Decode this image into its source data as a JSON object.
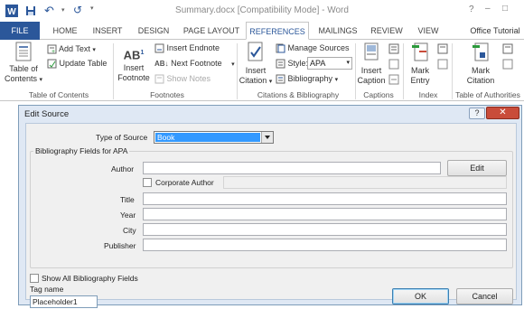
{
  "window": {
    "title": "Summary.docx [Compatibility Mode] - Word"
  },
  "title_controls": {
    "help": "?",
    "minimize": "–",
    "restore": "□"
  },
  "quick_access": {
    "undo_label": "↶",
    "redo_label": "↺"
  },
  "tabs": [
    {
      "label": "FILE"
    },
    {
      "label": "HOME"
    },
    {
      "label": "INSERT"
    },
    {
      "label": "DESIGN"
    },
    {
      "label": "PAGE LAYOUT"
    },
    {
      "label": "REFERENCES"
    },
    {
      "label": "MAILINGS"
    },
    {
      "label": "REVIEW"
    },
    {
      "label": "VIEW"
    },
    {
      "label": "Office Tutorial"
    }
  ],
  "ribbon": {
    "toc": {
      "table_of_contents_line1": "Table of",
      "table_of_contents_line2": "Contents",
      "add_text": "Add Text",
      "update_table": "Update Table",
      "group_label": "Table of Contents"
    },
    "footnotes": {
      "insert_footnote_line1": "Insert",
      "insert_footnote_line2": "Footnote",
      "insert_endnote": "Insert Endnote",
      "next_footnote": "Next Footnote",
      "show_notes": "Show Notes",
      "group_label": "Footnotes",
      "ab_icon_text": "AB",
      "ab_sup": "1"
    },
    "citations": {
      "insert_citation_line1": "Insert",
      "insert_citation_line2": "Citation",
      "manage_sources": "Manage Sources",
      "style_label": "Style:",
      "style_value": "APA",
      "bibliography": "Bibliography",
      "group_label": "Citations & Bibliography"
    },
    "captions": {
      "insert_caption_line1": "Insert",
      "insert_caption_line2": "Caption",
      "group_label": "Captions"
    },
    "index": {
      "mark_entry_line1": "Mark",
      "mark_entry_line2": "Entry",
      "group_label": "Index"
    },
    "authorities": {
      "mark_citation_line1": "Mark",
      "mark_citation_line2": "Citation",
      "group_label": "Table of Authorities"
    }
  },
  "dialog": {
    "title": "Edit Source",
    "help_label": "?",
    "close_label": "✕",
    "type_of_source_label": "Type of Source",
    "type_of_source_value": "Book",
    "fields_heading": "Bibliography Fields for APA",
    "author_label": "Author",
    "author_value": "",
    "edit_button": "Edit",
    "corporate_author_label": "Corporate Author",
    "corporate_author_value": "",
    "title_label": "Title",
    "title_value": "",
    "year_label": "Year",
    "year_value": "",
    "city_label": "City",
    "city_value": "",
    "publisher_label": "Publisher",
    "publisher_value": "",
    "show_all_label": "Show All Bibliography Fields",
    "tag_name_label": "Tag name",
    "tag_name_value": "Placeholder1",
    "ok_button": "OK",
    "cancel_button": "Cancel"
  },
  "colors": {
    "accent": "#2b579a",
    "close_red": "#c94c3a",
    "selection_blue": "#3399ff"
  }
}
